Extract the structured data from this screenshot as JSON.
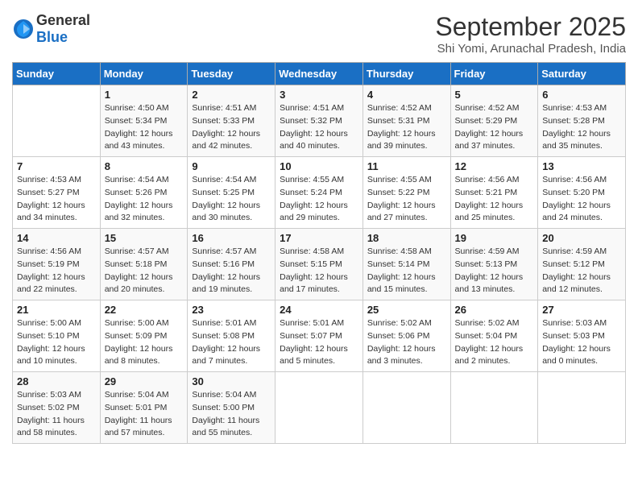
{
  "header": {
    "logo_general": "General",
    "logo_blue": "Blue",
    "month_title": "September 2025",
    "location": "Shi Yomi, Arunachal Pradesh, India"
  },
  "weekdays": [
    "Sunday",
    "Monday",
    "Tuesday",
    "Wednesday",
    "Thursday",
    "Friday",
    "Saturday"
  ],
  "weeks": [
    [
      {
        "num": "",
        "sunrise": "",
        "sunset": "",
        "daylight": ""
      },
      {
        "num": "1",
        "sunrise": "Sunrise: 4:50 AM",
        "sunset": "Sunset: 5:34 PM",
        "daylight": "Daylight: 12 hours and 43 minutes."
      },
      {
        "num": "2",
        "sunrise": "Sunrise: 4:51 AM",
        "sunset": "Sunset: 5:33 PM",
        "daylight": "Daylight: 12 hours and 42 minutes."
      },
      {
        "num": "3",
        "sunrise": "Sunrise: 4:51 AM",
        "sunset": "Sunset: 5:32 PM",
        "daylight": "Daylight: 12 hours and 40 minutes."
      },
      {
        "num": "4",
        "sunrise": "Sunrise: 4:52 AM",
        "sunset": "Sunset: 5:31 PM",
        "daylight": "Daylight: 12 hours and 39 minutes."
      },
      {
        "num": "5",
        "sunrise": "Sunrise: 4:52 AM",
        "sunset": "Sunset: 5:29 PM",
        "daylight": "Daylight: 12 hours and 37 minutes."
      },
      {
        "num": "6",
        "sunrise": "Sunrise: 4:53 AM",
        "sunset": "Sunset: 5:28 PM",
        "daylight": "Daylight: 12 hours and 35 minutes."
      }
    ],
    [
      {
        "num": "7",
        "sunrise": "Sunrise: 4:53 AM",
        "sunset": "Sunset: 5:27 PM",
        "daylight": "Daylight: 12 hours and 34 minutes."
      },
      {
        "num": "8",
        "sunrise": "Sunrise: 4:54 AM",
        "sunset": "Sunset: 5:26 PM",
        "daylight": "Daylight: 12 hours and 32 minutes."
      },
      {
        "num": "9",
        "sunrise": "Sunrise: 4:54 AM",
        "sunset": "Sunset: 5:25 PM",
        "daylight": "Daylight: 12 hours and 30 minutes."
      },
      {
        "num": "10",
        "sunrise": "Sunrise: 4:55 AM",
        "sunset": "Sunset: 5:24 PM",
        "daylight": "Daylight: 12 hours and 29 minutes."
      },
      {
        "num": "11",
        "sunrise": "Sunrise: 4:55 AM",
        "sunset": "Sunset: 5:22 PM",
        "daylight": "Daylight: 12 hours and 27 minutes."
      },
      {
        "num": "12",
        "sunrise": "Sunrise: 4:56 AM",
        "sunset": "Sunset: 5:21 PM",
        "daylight": "Daylight: 12 hours and 25 minutes."
      },
      {
        "num": "13",
        "sunrise": "Sunrise: 4:56 AM",
        "sunset": "Sunset: 5:20 PM",
        "daylight": "Daylight: 12 hours and 24 minutes."
      }
    ],
    [
      {
        "num": "14",
        "sunrise": "Sunrise: 4:56 AM",
        "sunset": "Sunset: 5:19 PM",
        "daylight": "Daylight: 12 hours and 22 minutes."
      },
      {
        "num": "15",
        "sunrise": "Sunrise: 4:57 AM",
        "sunset": "Sunset: 5:18 PM",
        "daylight": "Daylight: 12 hours and 20 minutes."
      },
      {
        "num": "16",
        "sunrise": "Sunrise: 4:57 AM",
        "sunset": "Sunset: 5:16 PM",
        "daylight": "Daylight: 12 hours and 19 minutes."
      },
      {
        "num": "17",
        "sunrise": "Sunrise: 4:58 AM",
        "sunset": "Sunset: 5:15 PM",
        "daylight": "Daylight: 12 hours and 17 minutes."
      },
      {
        "num": "18",
        "sunrise": "Sunrise: 4:58 AM",
        "sunset": "Sunset: 5:14 PM",
        "daylight": "Daylight: 12 hours and 15 minutes."
      },
      {
        "num": "19",
        "sunrise": "Sunrise: 4:59 AM",
        "sunset": "Sunset: 5:13 PM",
        "daylight": "Daylight: 12 hours and 13 minutes."
      },
      {
        "num": "20",
        "sunrise": "Sunrise: 4:59 AM",
        "sunset": "Sunset: 5:12 PM",
        "daylight": "Daylight: 12 hours and 12 minutes."
      }
    ],
    [
      {
        "num": "21",
        "sunrise": "Sunrise: 5:00 AM",
        "sunset": "Sunset: 5:10 PM",
        "daylight": "Daylight: 12 hours and 10 minutes."
      },
      {
        "num": "22",
        "sunrise": "Sunrise: 5:00 AM",
        "sunset": "Sunset: 5:09 PM",
        "daylight": "Daylight: 12 hours and 8 minutes."
      },
      {
        "num": "23",
        "sunrise": "Sunrise: 5:01 AM",
        "sunset": "Sunset: 5:08 PM",
        "daylight": "Daylight: 12 hours and 7 minutes."
      },
      {
        "num": "24",
        "sunrise": "Sunrise: 5:01 AM",
        "sunset": "Sunset: 5:07 PM",
        "daylight": "Daylight: 12 hours and 5 minutes."
      },
      {
        "num": "25",
        "sunrise": "Sunrise: 5:02 AM",
        "sunset": "Sunset: 5:06 PM",
        "daylight": "Daylight: 12 hours and 3 minutes."
      },
      {
        "num": "26",
        "sunrise": "Sunrise: 5:02 AM",
        "sunset": "Sunset: 5:04 PM",
        "daylight": "Daylight: 12 hours and 2 minutes."
      },
      {
        "num": "27",
        "sunrise": "Sunrise: 5:03 AM",
        "sunset": "Sunset: 5:03 PM",
        "daylight": "Daylight: 12 hours and 0 minutes."
      }
    ],
    [
      {
        "num": "28",
        "sunrise": "Sunrise: 5:03 AM",
        "sunset": "Sunset: 5:02 PM",
        "daylight": "Daylight: 11 hours and 58 minutes."
      },
      {
        "num": "29",
        "sunrise": "Sunrise: 5:04 AM",
        "sunset": "Sunset: 5:01 PM",
        "daylight": "Daylight: 11 hours and 57 minutes."
      },
      {
        "num": "30",
        "sunrise": "Sunrise: 5:04 AM",
        "sunset": "Sunset: 5:00 PM",
        "daylight": "Daylight: 11 hours and 55 minutes."
      },
      {
        "num": "",
        "sunrise": "",
        "sunset": "",
        "daylight": ""
      },
      {
        "num": "",
        "sunrise": "",
        "sunset": "",
        "daylight": ""
      },
      {
        "num": "",
        "sunrise": "",
        "sunset": "",
        "daylight": ""
      },
      {
        "num": "",
        "sunrise": "",
        "sunset": "",
        "daylight": ""
      }
    ]
  ]
}
